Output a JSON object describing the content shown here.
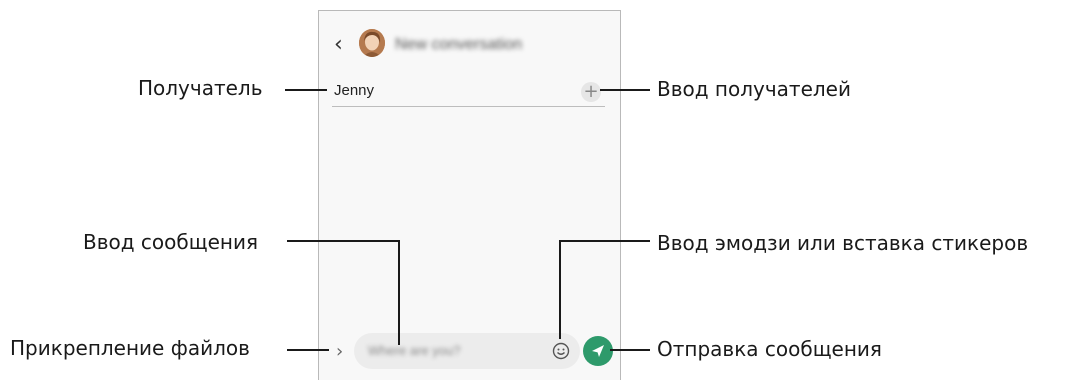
{
  "callouts": {
    "recipient": "Получатель",
    "add_recipients": "Ввод получателей",
    "message_input": "Ввод сообщения",
    "emoji_stickers": "Ввод эмодзи или вставка стикеров",
    "attach_files": "Прикрепление файлов",
    "send_message": "Отправка сообщения"
  },
  "phone": {
    "header_title": "New conversation",
    "recipient_name": "Jenny",
    "message_placeholder": "Where are you?",
    "icons": [
      "back-arrow-icon",
      "avatar",
      "plus-icon",
      "chevron-right-icon",
      "emoji-icon",
      "send-icon"
    ],
    "colors": {
      "send_button": "#2e9a6b",
      "screen_bg": "#f8f8f8",
      "field_bg": "#ececec"
    }
  }
}
